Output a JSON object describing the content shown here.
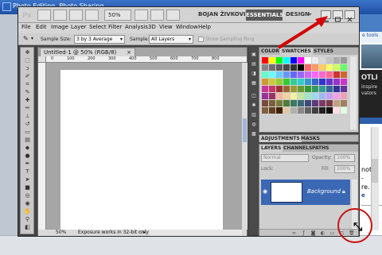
{
  "browser": {
    "title": "Photo Editing, Photo Sharing",
    "side_tools": "e tools",
    "side_heading": "OTLI",
    "side_sub1": "inspire",
    "side_sub2": "vators",
    "side_text1": "notos -",
    "side_text2": "re.",
    "side_link": "e"
  },
  "appbar": {
    "logo": "Ps",
    "zoom": "50%",
    "user": "BOJAN ŽIVKOVIĆ",
    "workspace_active": "ESSENTIALS",
    "workspace_design": "DESIGN",
    "more": "»"
  },
  "menu": [
    "File",
    "Edit",
    "Image",
    "Layer",
    "Select",
    "Filter",
    "Analysis",
    "3D",
    "View",
    "Window",
    "Help"
  ],
  "options": {
    "sample_size_label": "Sample Size:",
    "sample_size_value": "3 by 3 Average",
    "sample_label": "Sample:",
    "sample_value": "All Layers",
    "show_ring": "Show Sampling Ring"
  },
  "document": {
    "tab_title": "Untitled-1 @ 50% (RGB/8)",
    "tab_close": "×",
    "ruler_ticks": [
      "0",
      "100",
      "200",
      "300",
      "400",
      "500",
      "600",
      "700",
      "800"
    ],
    "status_zoom": "50%",
    "status_message": "Exposure works in 32-bit only"
  },
  "swatches_panel": {
    "tabs": [
      "COLOR",
      "SWATCHES",
      "STYLES"
    ],
    "active_tab": "SWATCHES",
    "colors": [
      "#ff0000",
      "#ffff00",
      "#00ff00",
      "#00ffff",
      "#0000ff",
      "#ff00ff",
      "#ffffff",
      "#ebebeb",
      "#d6d6d6",
      "#c2c2c2",
      "#adadad",
      "#999999",
      "#858585",
      "#707070",
      "#5c5c5c",
      "#474747",
      "#333333",
      "#000000",
      "#ff6666",
      "#ff9966",
      "#ffcc66",
      "#ffff66",
      "#ccff66",
      "#66ff66",
      "#66ffcc",
      "#66ffff",
      "#66ccff",
      "#6699ff",
      "#6666ff",
      "#9966ff",
      "#cc66ff",
      "#ff66ff",
      "#ff66cc",
      "#ff6699",
      "#cc3333",
      "#cc6633",
      "#cc9933",
      "#cccc33",
      "#99cc33",
      "#33cc33",
      "#33cc99",
      "#33cccc",
      "#3399cc",
      "#3366cc",
      "#3333cc",
      "#6633cc",
      "#9933cc",
      "#cc33cc",
      "#cc3399",
      "#cc3366",
      "#993333",
      "#996633",
      "#999933",
      "#669933",
      "#339933",
      "#339966",
      "#339999",
      "#336699",
      "#333399",
      "#663399",
      "#993399",
      "#993366",
      "#f2b8a0",
      "#f2d2a0",
      "#f2f2a0",
      "#c6e6a0",
      "#a0e6c6",
      "#a0d8f2",
      "#a0b8f2",
      "#c6a0f2",
      "#f2a0e6",
      "#f2a0b8",
      "#7a4a3a",
      "#7a5f3a",
      "#7a7a3a",
      "#4f7a3a",
      "#3a7a5f",
      "#3a6a7a",
      "#3a4a7a",
      "#5f3a7a",
      "#7a3a6a",
      "#7a3a4a",
      "#c0a080",
      "#a08060",
      "#806040",
      "#604020",
      "#402000",
      "#e0c8a0",
      "#b0b0b0",
      "#888888",
      "#606060",
      "#404040",
      "#202020",
      "#101010",
      "#ffe0e0",
      "#e0ffe0"
    ]
  },
  "adjustments_panel": {
    "tabs": [
      "ADJUSTMENTS",
      "MASKS"
    ]
  },
  "layers_panel": {
    "tabs": [
      "LAYERS",
      "CHANNELS",
      "PATHS"
    ],
    "active_tab": "LAYERS",
    "blend_mode": "Normal",
    "opacity_label": "Opacity:",
    "opacity_value": "100%",
    "lock_label": "Lock:",
    "fill_label": "Fill:",
    "fill_value": "100%",
    "layer_name": "Background"
  }
}
